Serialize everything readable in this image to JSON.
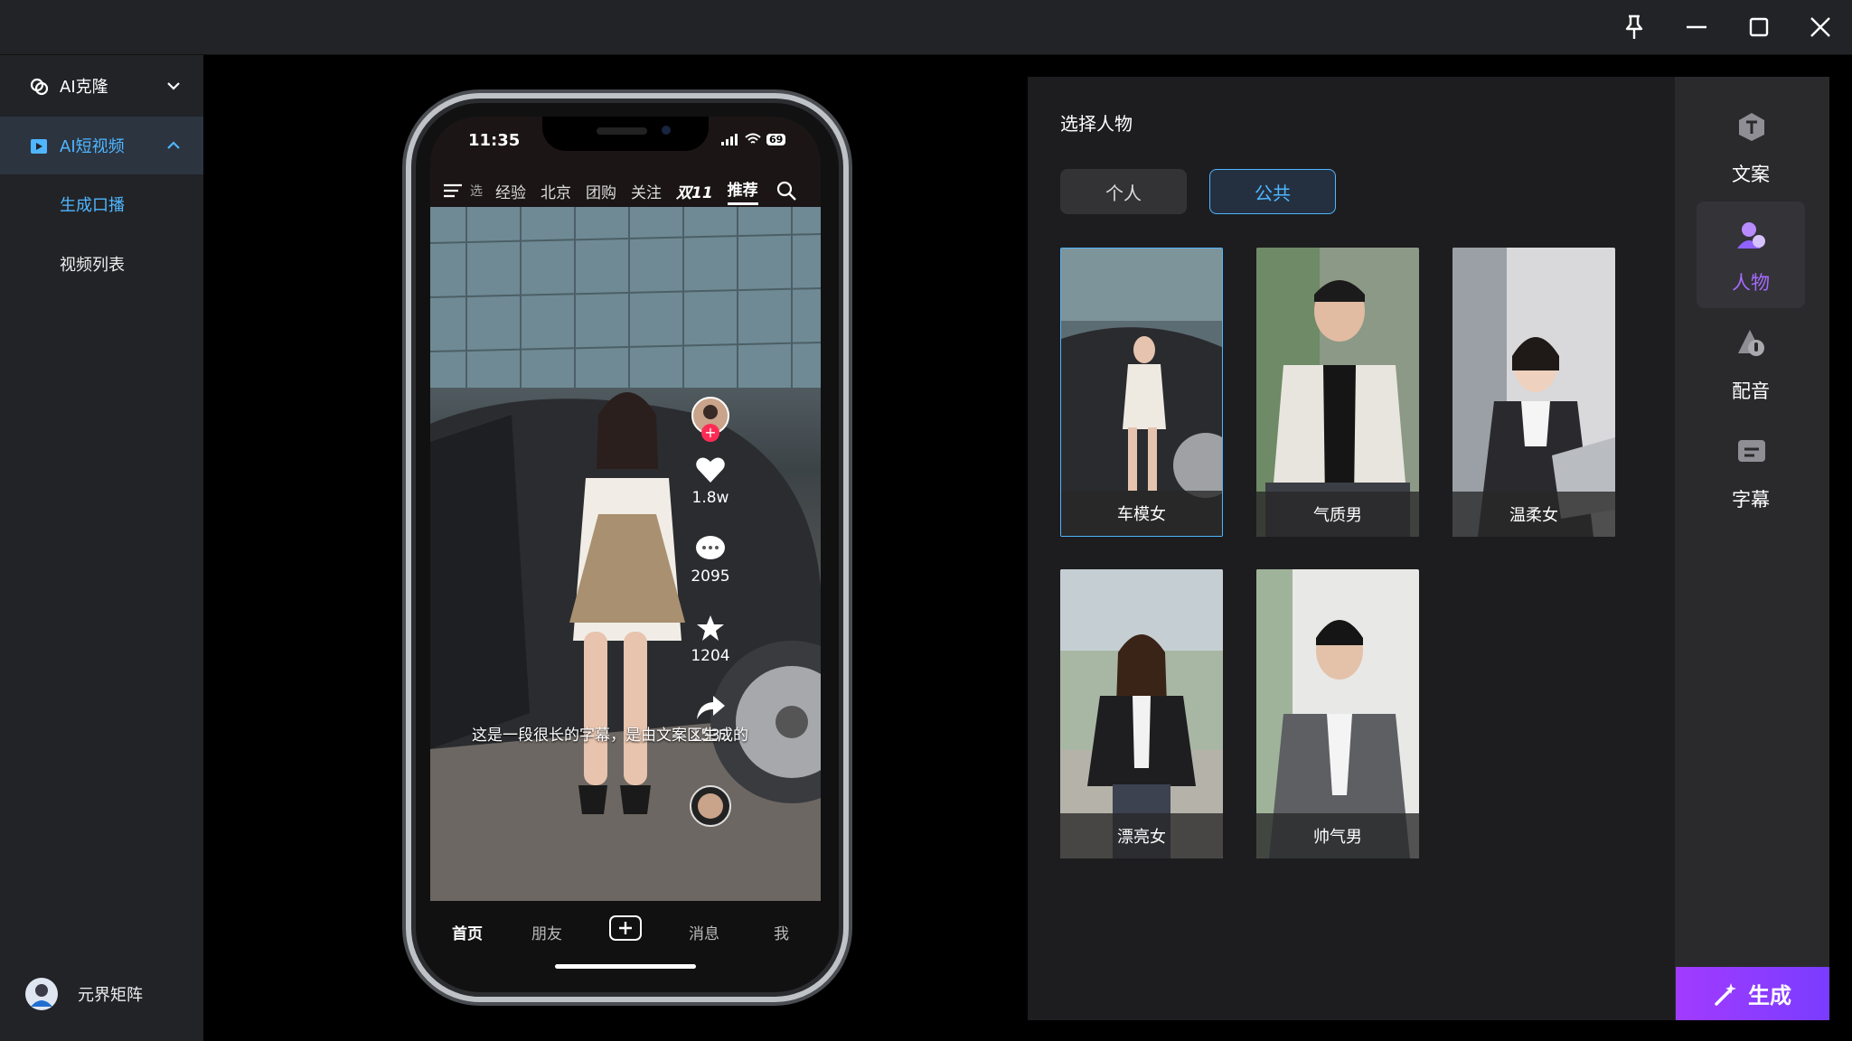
{
  "sidebar": {
    "groups": [
      {
        "label": "AI克隆",
        "expanded": false
      },
      {
        "label": "AI短视频",
        "expanded": true
      }
    ],
    "sub_items": [
      "生成口播",
      "视频列表"
    ],
    "user_name": "元界矩阵"
  },
  "phone": {
    "time": "11:35",
    "battery": "69",
    "nav_items": [
      "经验",
      "北京",
      "团购",
      "关注",
      "双11",
      "推荐"
    ],
    "nav_partial": "选",
    "likes": "1.8w",
    "comments": "2095",
    "favorites": "1204",
    "shares": "1532",
    "subtitle": "这是一段很长的字幕，是由文案区生成的",
    "tabs": [
      "首页",
      "朋友",
      "消息",
      "我"
    ]
  },
  "panel": {
    "title": "选择人物",
    "segments": [
      "个人",
      "公共"
    ],
    "active_segment": "公共",
    "characters": [
      "车模女",
      "气质男",
      "温柔女",
      "漂亮女",
      "帅气男"
    ],
    "selected_character": "车模女"
  },
  "rail": {
    "items": [
      {
        "label": "文案",
        "icon": "text-icon"
      },
      {
        "label": "人物",
        "icon": "person-icon"
      },
      {
        "label": "配音",
        "icon": "voice-icon"
      },
      {
        "label": "字幕",
        "icon": "subtitle-icon"
      }
    ],
    "active": "人物"
  },
  "generate_label": "生成",
  "colors": {
    "accent_blue": "#4fb6ff",
    "accent_purple": "#a66bff",
    "generate_gradient_start": "#a13bff",
    "generate_gradient_end": "#7a3cff"
  }
}
